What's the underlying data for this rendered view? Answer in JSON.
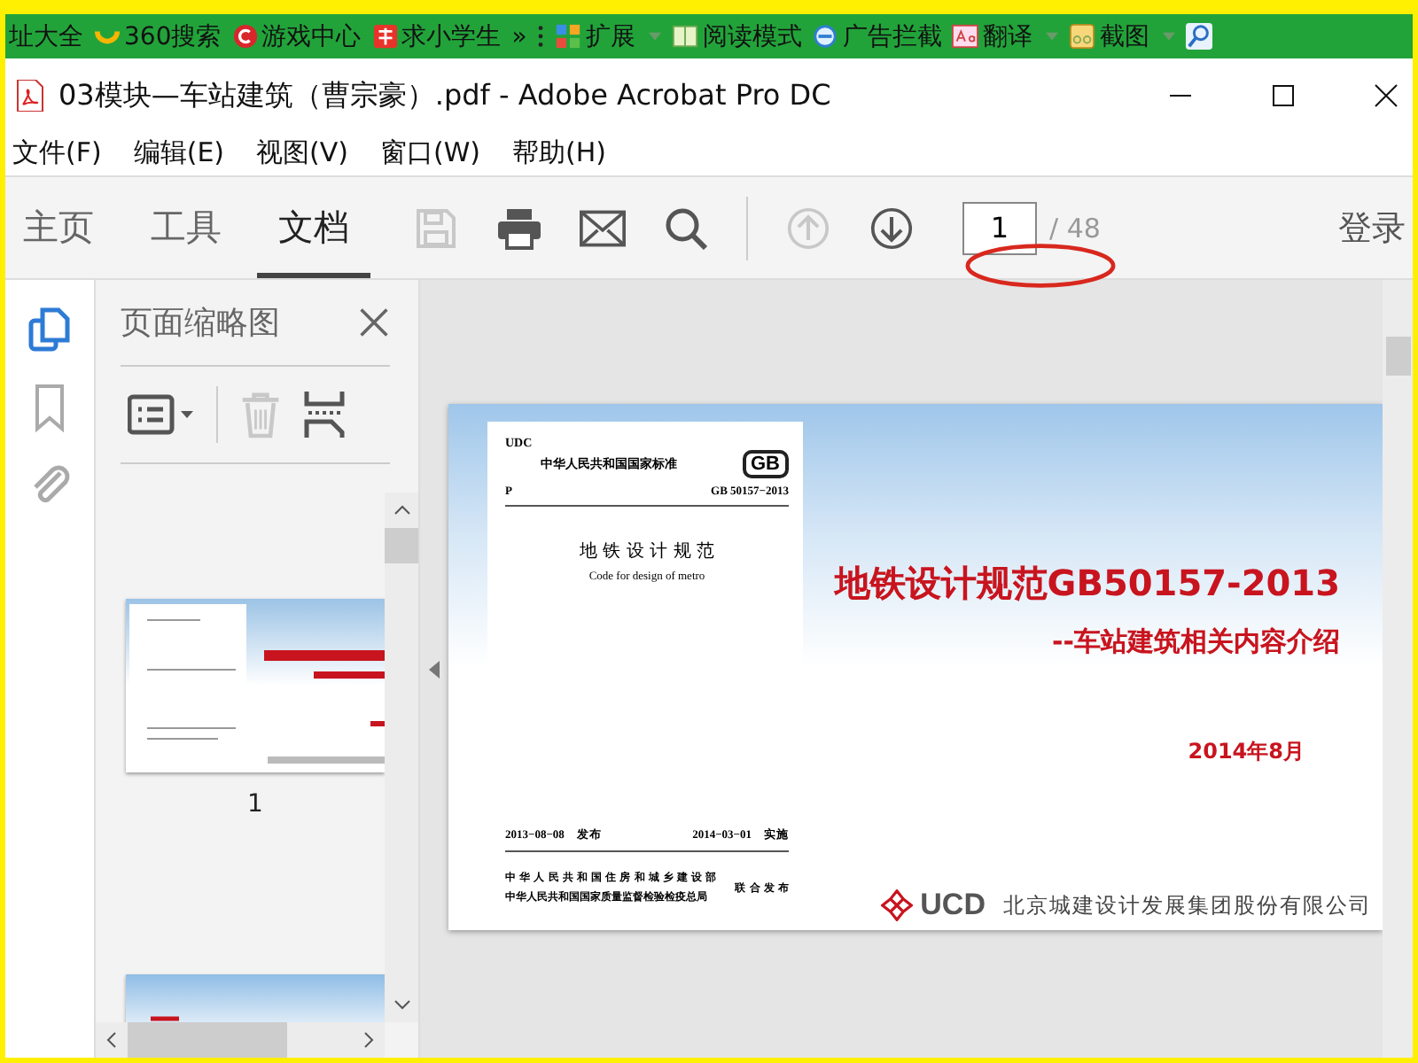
{
  "browser_bar": {
    "items": [
      {
        "label": "址大全",
        "kind": "plain"
      },
      {
        "label": "360搜索",
        "kind": "ring"
      },
      {
        "label": "游戏中心",
        "kind": "game"
      },
      {
        "label": "求小学生",
        "kind": "badge"
      },
      {
        "label": "»",
        "kind": "plain"
      },
      {
        "label": "扩展",
        "kind": "grid",
        "dropdown": true
      },
      {
        "label": "阅读模式",
        "kind": "book"
      },
      {
        "label": "广告拦截",
        "kind": "block"
      },
      {
        "label": "翻译",
        "kind": "translate",
        "dropdown": true
      },
      {
        "label": "截图",
        "kind": "scissors",
        "dropdown": true
      }
    ],
    "search_icon": true
  },
  "window": {
    "title": "03模块—车站建筑（曹宗豪）.pdf - Adobe Acrobat Pro DC"
  },
  "menu": [
    "文件(F)",
    "编辑(E)",
    "视图(V)",
    "窗口(W)",
    "帮助(H)"
  ],
  "toolbar": {
    "tabs": [
      {
        "label": "主页",
        "selected": false
      },
      {
        "label": "工具",
        "selected": false
      },
      {
        "label": "文档",
        "selected": true
      }
    ],
    "tools": [
      {
        "kind": "save",
        "disabled": true
      },
      {
        "kind": "print",
        "disabled": false
      },
      {
        "kind": "mail",
        "disabled": false
      },
      {
        "kind": "search",
        "disabled": false
      },
      {
        "kind": "sep"
      },
      {
        "kind": "up",
        "disabled": true
      },
      {
        "kind": "down",
        "disabled": false
      }
    ],
    "page_number": "1",
    "page_total": "/ 48",
    "login": "登录"
  },
  "side_rail": [
    {
      "kind": "pages",
      "selected": true
    },
    {
      "kind": "bookmark",
      "selected": false
    },
    {
      "kind": "attach",
      "selected": false
    }
  ],
  "thumbnail_panel": {
    "title": "页面缩略图",
    "tools": [
      {
        "kind": "options",
        "disabled": false
      },
      {
        "kind": "trash",
        "disabled": true
      },
      {
        "kind": "crop",
        "disabled": false
      }
    ],
    "thumbnails": [
      {
        "kind": "cover",
        "label": "1"
      },
      {
        "kind": "list"
      }
    ]
  },
  "document_page": {
    "udc": "UDC",
    "standard": "中华人民共和国国家标准",
    "gb_logo": "GB",
    "p": "P",
    "code": "GB 50157−2013",
    "name_cn": "地 铁 设 计 规 范",
    "name_en": "Code for design of metro",
    "issued": "2013−08−08　发布",
    "effective": "2014−03−01　实施",
    "ministry_1": "中 华 人 民 共 和 国 住 房 和 城 乡 建 设 部",
    "ministry_2": "中华人民共和国国家质量监督检验检疫总局",
    "joint": "联 合 发 布",
    "title": "地铁设计规范GB50157-2013",
    "subtitle": "--车站建筑相关内容介绍",
    "date": "2014年8月",
    "company": "北京城建设计发展集团股份有限公司",
    "company_logo": "UCD"
  }
}
